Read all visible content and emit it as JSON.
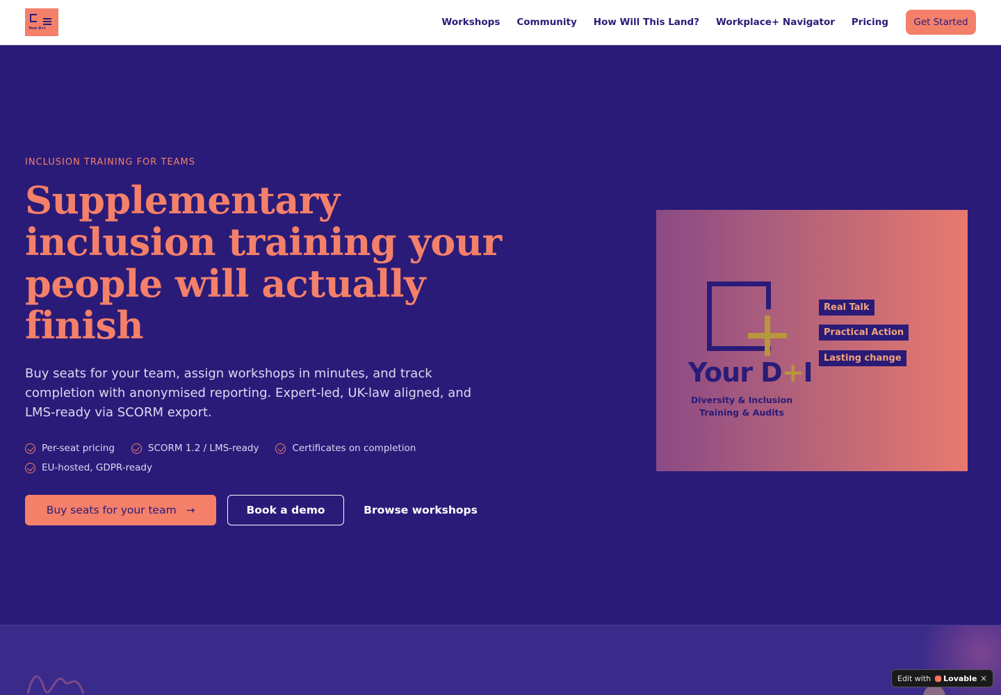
{
  "nav": {
    "logo_text": "Your D+I",
    "links": [
      "Workshops",
      "Community",
      "How Will This Land?",
      "Workplace+ Navigator",
      "Pricing"
    ],
    "cta": "Get Started"
  },
  "hero": {
    "eyebrow": "INCLUSION TRAINING FOR TEAMS",
    "headline": "Supplementary inclusion training your people will actually finish",
    "subtitle": "Buy seats for your team, assign workshops in minutes, and track completion with anonymised reporting. Expert-led, UK-law aligned, and LMS-ready via SCORM export.",
    "features": [
      "Per-seat pricing",
      "SCORM 1.2 / LMS-ready",
      "Certificates on completion",
      "EU-hosted, GDPR-ready"
    ],
    "buttons": {
      "primary": "Buy seats for your team",
      "secondary": "Book a demo",
      "tertiary": "Browse workshops"
    }
  },
  "hero_image": {
    "brand_prefix": "Your D",
    "brand_plus": "+",
    "brand_suffix": "I",
    "tagline_line1": "Diversity & Inclusion",
    "tagline_line2": "Training & Audits",
    "pills": [
      "Real Talk",
      "Practical Action",
      "Lasting change"
    ]
  },
  "badge": {
    "prefix": "Edit with",
    "brand": "Lovable",
    "close": "×"
  },
  "colors": {
    "primary": "#2a1b78",
    "accent": "#f4806a",
    "gold": "#b8963c",
    "white": "#ffffff"
  }
}
